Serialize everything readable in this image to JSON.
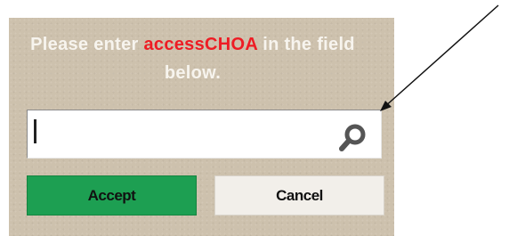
{
  "dialog": {
    "prompt_before": "Please enter ",
    "prompt_code": "accessCHOA",
    "prompt_after": " in the field below.",
    "input_value": "",
    "accept_label": "Accept",
    "cancel_label": "Cancel"
  },
  "colors": {
    "panel_background": "#cdc1ad",
    "prompt_text": "#f7f4ee",
    "code_highlight": "#ee1c24",
    "accept_button": "#1d9f52",
    "cancel_button": "#f2efea"
  },
  "icons": {
    "field_icon": "search-icon"
  }
}
